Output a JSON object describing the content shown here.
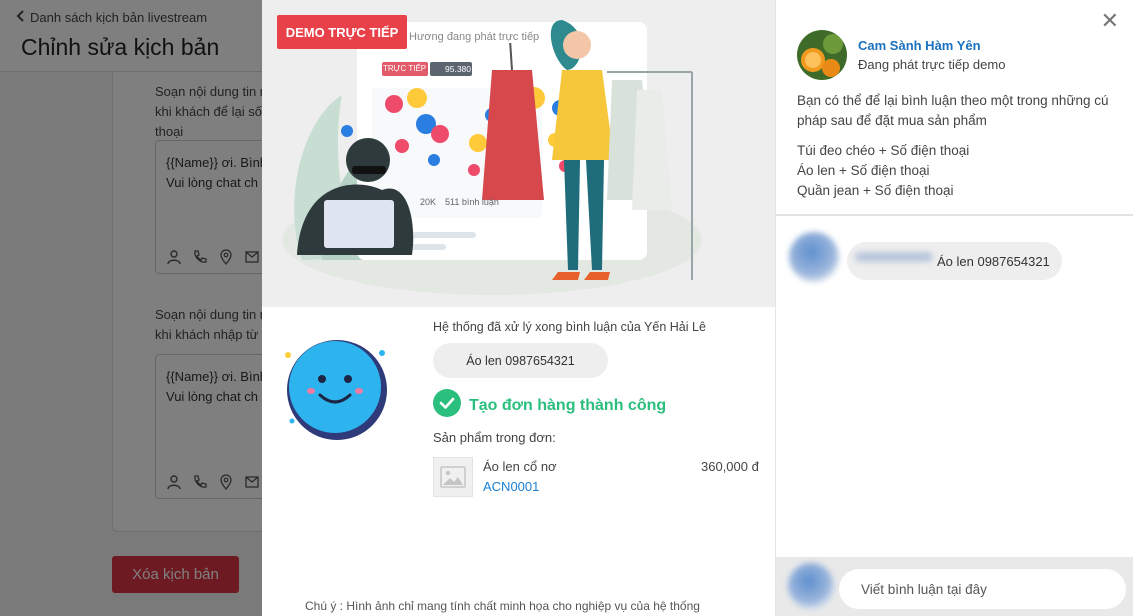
{
  "background": {
    "breadcrumb": "Danh sách kịch bản livestream",
    "page_title": "Chỉnh sửa kịch bản",
    "section1_label": "Soạn nội dung tin nhắn khi khách để lại số điện thoại",
    "section1_line1": "{{Name}} ơi. Bình",
    "section1_line2": "Vui lòng chat ch",
    "section2_label": "Soạn nội dung tin nhắn khi khách nhập từ khóa",
    "section2_line1": "{{Name}} ơi. Bình",
    "section2_line2": "Vui lòng chat ch",
    "delete_button": "Xóa kịch bản"
  },
  "demo": {
    "badge": "DEMO TRỰC TIẾP",
    "illustration": {
      "stream_title": "Hương đang phát trực tiếp",
      "live_tag": "TRỰC TIẾP",
      "viewers": "95.380",
      "reactions": "20K",
      "comments": "511 bình luận"
    },
    "process": {
      "system_text": "Hệ thống đã xử lý xong bình luận của Yến Hải Lê",
      "comment": "Áo len 0987654321",
      "success_text": "Tạo đơn hàng thành công",
      "products_label": "Sản phẩm trong đơn:",
      "product_name": "Áo len cổ nơ",
      "product_code": "ACN0001",
      "product_price": "360,000  đ",
      "note": "Chú ý : Hình ảnh chỉ mang tính chất minh họa cho nghiệp vụ của hệ thống"
    }
  },
  "panel": {
    "shop_name": "Cam Sành Hàm Yên",
    "shop_status": "Đang phát trực tiếp demo",
    "instruction": "Bạn có thể để lại bình luận theo một trong những cú pháp sau để đặt mua sản phẩm",
    "syntax": [
      "Túi đeo chéo + Số điện thoại",
      "Áo len + Số điện thoại",
      "Quần jean + Số điện thoại"
    ],
    "comment_text": "Áo len 0987654321",
    "composer_placeholder": "Viết bình luận tại đây"
  },
  "icons": {
    "back": "chevron-left-icon",
    "close": "close-icon",
    "success": "check-circle-icon",
    "product_image": "image-placeholder-icon"
  },
  "colors": {
    "badge_red": "#e9414a",
    "success_green": "#2bbf7e",
    "link_blue": "#1a7fd4",
    "delete_red": "#dc3545"
  }
}
